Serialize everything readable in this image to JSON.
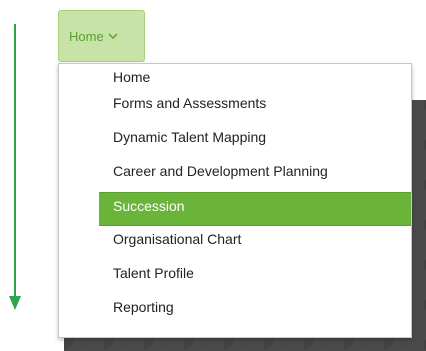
{
  "nav": {
    "home_label": "Home",
    "home_icon": "chevron-down-icon",
    "accent_color": "#6ab43a",
    "menu_items": [
      {
        "label": "Home"
      },
      {
        "label": "Forms and Assessments"
      },
      {
        "label": "Dynamic Talent Mapping"
      },
      {
        "label": "Career and Development Planning"
      },
      {
        "label": "Succession",
        "active": true
      },
      {
        "label": "Organisational Chart"
      },
      {
        "label": "Talent Profile"
      },
      {
        "label": "Reporting"
      }
    ]
  },
  "annotation": {
    "arrow_icon": "arrow-down-icon",
    "arrow_color": "#2ea54a"
  }
}
